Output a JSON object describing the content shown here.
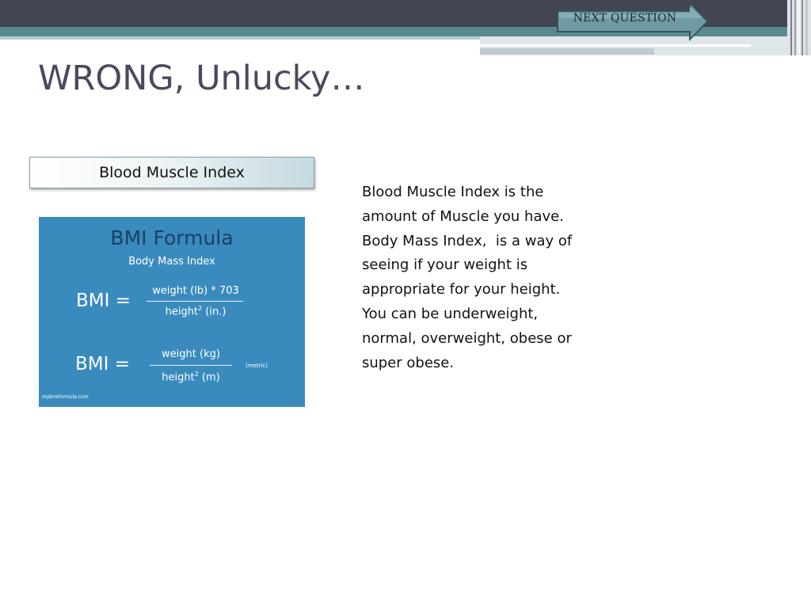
{
  "header": {
    "next_button_label": "NEXT QUESTION"
  },
  "slide": {
    "title": "WRONG, Unlucky…",
    "label_box": "Blood Muscle Index",
    "body_lines": [
      "Blood Muscle Index is the",
      "amount of Muscle you have.",
      "Body Mass Index,  is a way of",
      "seeing if your weight is",
      "appropriate for your height.",
      "You can be underweight,",
      "normal, overweight, obese or",
      "super obese."
    ]
  },
  "bmi_image": {
    "title": "BMI Formula",
    "subtitle": "Body Mass Index",
    "eq_label": "BMI =",
    "imperial_numerator": "weight (lb) * 703",
    "imperial_denominator_base": "height",
    "imperial_denominator_exp": "2",
    "imperial_denominator_unit": " (in.)",
    "metric_numerator": "weight (kg)",
    "metric_denominator_base": "height",
    "metric_denominator_exp": "2",
    "metric_denominator_unit": " (m)",
    "metric_note": "(metric)",
    "source": "mybmiformula.com"
  },
  "colors": {
    "top_bar": "#434454",
    "teal_band": "#5a8a90",
    "title_text": "#4a4a5e",
    "image_background": "#3a8bbd"
  }
}
